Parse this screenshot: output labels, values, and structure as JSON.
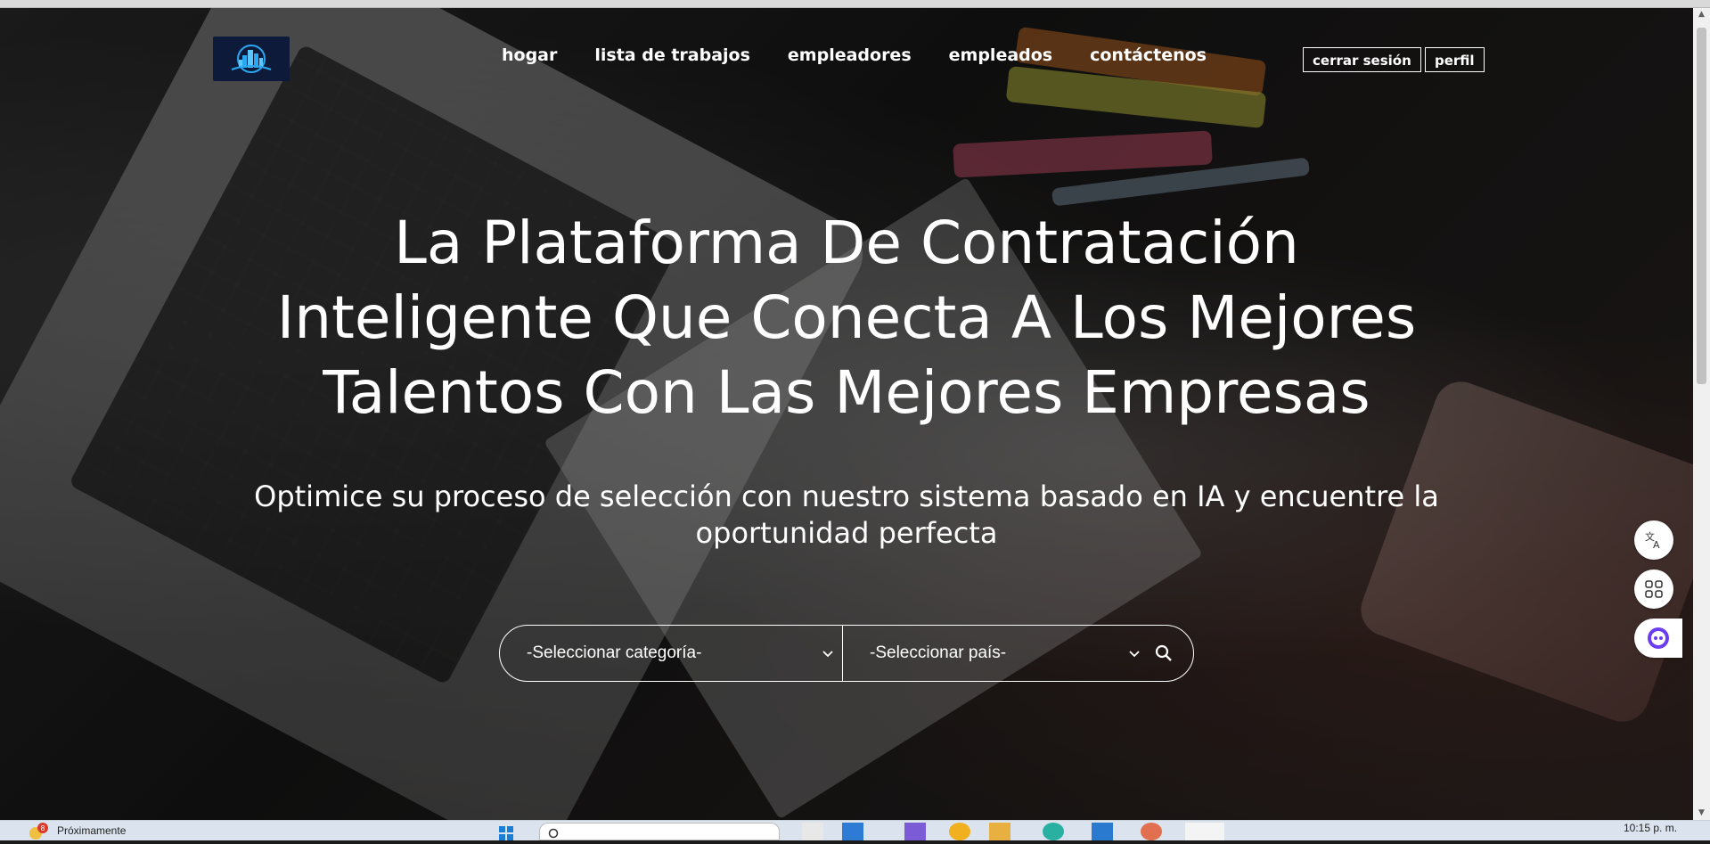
{
  "nav": {
    "links": [
      "hogar",
      "lista de trabajos",
      "empleadores",
      "empleados",
      "contáctenos"
    ],
    "logout_label": "cerrar sesión",
    "profile_label": "perfil"
  },
  "hero": {
    "title_lines": [
      "La Plataforma De Contratación",
      "Inteligente Que Conecta A Los Mejores",
      "Talentos Con Las Mejores Empresas"
    ],
    "subtitle_lines": [
      "Optimice su proceso de selección con nuestro sistema basado en IA y encuentre la",
      "oportunidad perfecta"
    ]
  },
  "search": {
    "category_value": "-Seleccionar categoría-",
    "country_value": "-Seleccionar país-"
  },
  "side_tools": [
    "translate-icon",
    "apps-grid-icon",
    "assistant-icon"
  ],
  "taskbar": {
    "notification_count": "8",
    "weather_label": "Próximamente",
    "clock": "10:15 p. m."
  },
  "colors": {
    "accent": "#ffffff",
    "logo_bg": "#0d1a3a",
    "logo_icon": "#2aa8f0",
    "badge": "#d93a2b"
  }
}
